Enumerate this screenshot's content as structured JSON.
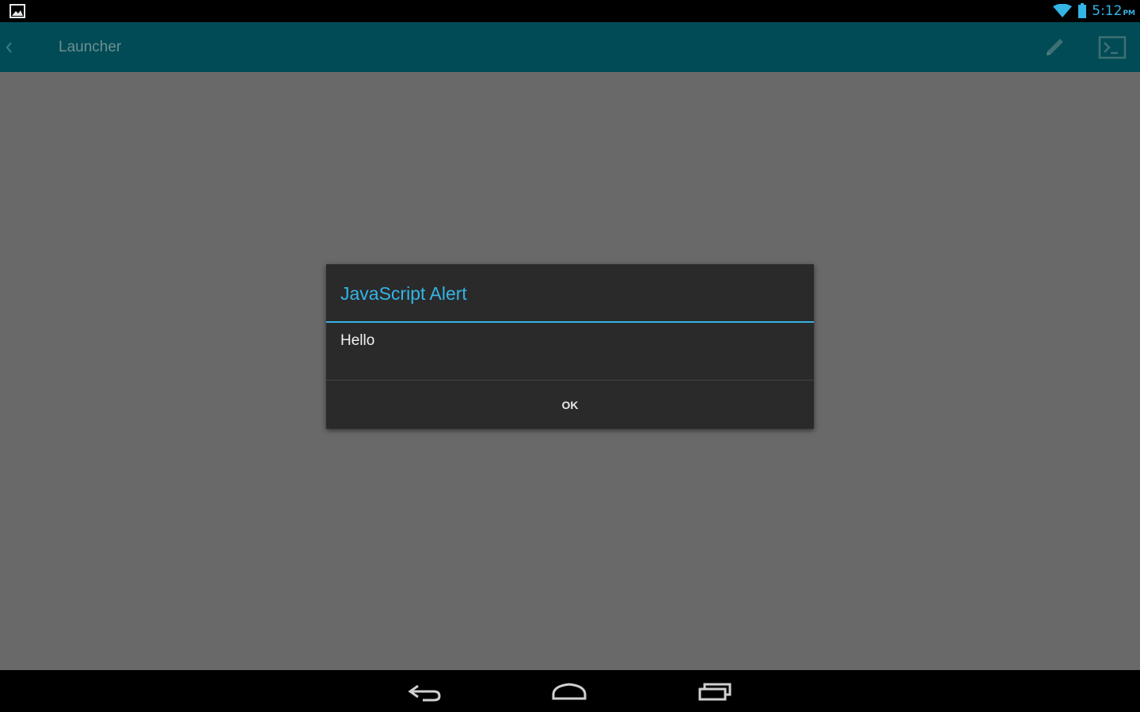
{
  "status_bar": {
    "left_icon": "image-notification-icon",
    "wifi_icon": "wifi-icon",
    "battery_icon": "battery-icon",
    "time": "5:12",
    "time_suffix": "PM"
  },
  "action_bar": {
    "back_icon": "chevron-left-icon",
    "title": "Launcher",
    "edit_icon": "pencil-icon",
    "console_icon": "terminal-icon",
    "color": "#004b55"
  },
  "dialog": {
    "title": "JavaScript Alert",
    "message": "Hello",
    "ok_label": "OK",
    "accent_color": "#33b5e5"
  },
  "nav_bar": {
    "back_icon": "back-arrow-icon",
    "home_icon": "home-icon",
    "recents_icon": "recent-apps-icon"
  }
}
